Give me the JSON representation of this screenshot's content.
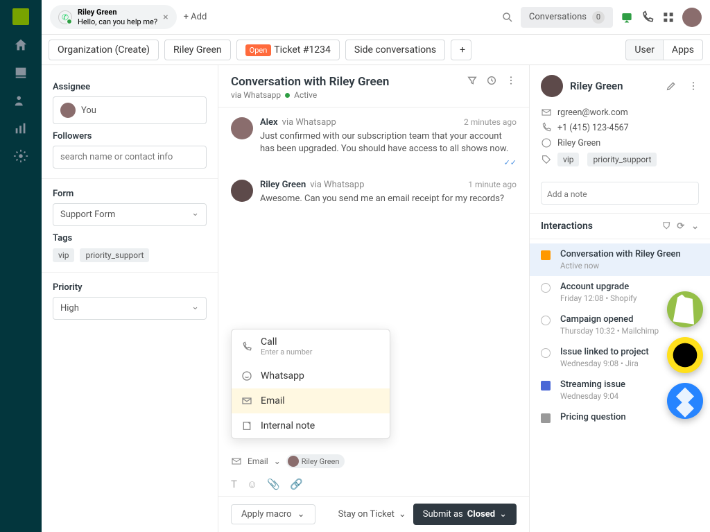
{
  "topbar": {
    "active_tab": {
      "name": "Riley Green",
      "preview": "Hello, can you help me?"
    },
    "add_label": "+ Add",
    "conversations_label": "Conversations",
    "conversations_count": "0"
  },
  "tabs": {
    "org": "Organization (Create)",
    "customer": "Riley Green",
    "open_badge": "Open",
    "ticket": "Ticket #1234",
    "side": "Side conversations",
    "user": "User",
    "apps": "Apps"
  },
  "left": {
    "assignee_label": "Assignee",
    "assignee_value": "You",
    "followers_label": "Followers",
    "followers_placeholder": "search name or contact info",
    "form_label": "Form",
    "form_value": "Support Form",
    "tags_label": "Tags",
    "tags": [
      "vip",
      "priority_support"
    ],
    "priority_label": "Priority",
    "priority_value": "High"
  },
  "conversation": {
    "title": "Conversation with Riley Green",
    "via": "via Whatsapp",
    "status": "Active",
    "messages": [
      {
        "author": "Alex",
        "via": "via Whatsapp",
        "time": "2 minutes ago",
        "text": "Just confirmed with our subscription team that your account has been upgraded. You should have access to all shows now."
      },
      {
        "author": "Riley Green",
        "via": "via Whatsapp",
        "time": "1 minute ago",
        "text": "Awesome. Can you send me an email receipt for my records?"
      }
    ],
    "compose_options": {
      "call": "Call",
      "call_sub": "Enter a number",
      "whatsapp": "Whatsapp",
      "email": "Email",
      "note": "Internal note"
    },
    "compose_channel": "Email",
    "recipient": "Riley Green",
    "macro_label": "Apply macro",
    "stay_label": "Stay on Ticket",
    "submit_prefix": "Submit as",
    "submit_status": "Closed"
  },
  "profile": {
    "name": "Riley Green",
    "email": "rgreen@work.com",
    "phone": "+1 (415) 123-4567",
    "whatsapp": "Riley Green",
    "tags": [
      "vip",
      "priority_support"
    ],
    "note_placeholder": "Add a note"
  },
  "interactions": {
    "heading": "Interactions",
    "items": [
      {
        "title": "Conversation with Riley Green",
        "meta": "Active now",
        "kind": "active"
      },
      {
        "title": "Account upgrade",
        "meta": "Friday 12:08 • Shopify",
        "kind": "circle"
      },
      {
        "title": "Campaign opened",
        "meta": "Thursday 10:32 • Mailchimp",
        "kind": "circle"
      },
      {
        "title": "Issue linked to project",
        "meta": "Wednesday 9:08 • Jira",
        "kind": "circle"
      },
      {
        "title": "Streaming issue",
        "meta": "Wednesday 9:04",
        "kind": "square"
      },
      {
        "title": "Pricing question",
        "meta": "",
        "kind": "sq2"
      }
    ]
  }
}
